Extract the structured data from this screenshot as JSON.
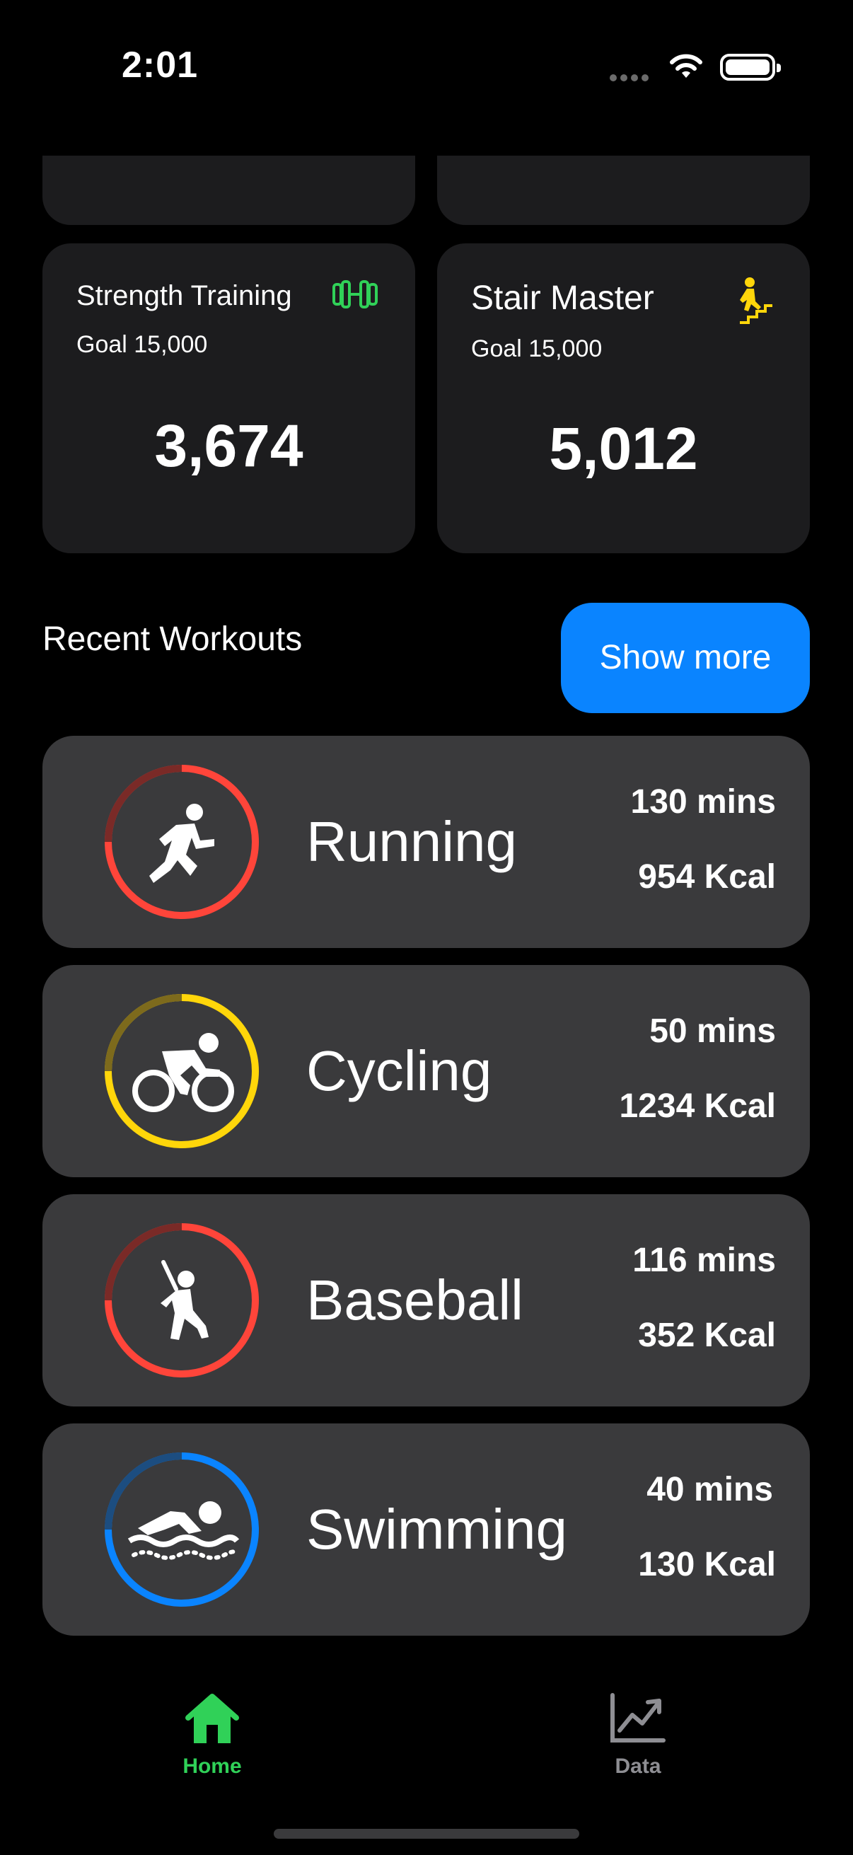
{
  "status_bar": {
    "time": "2:01"
  },
  "stats": [
    {
      "title": "Strength Training",
      "goal": "Goal 15,000",
      "value": "3,674",
      "icon": "dumbbell-icon",
      "icon_color": "#30d158"
    },
    {
      "title": "Stair Master",
      "goal": "Goal 15,000",
      "value": "5,012",
      "icon": "stairs-icon",
      "icon_color": "#ffd60a"
    }
  ],
  "recent": {
    "title": "Recent Workouts",
    "show_more_label": "Show more",
    "items": [
      {
        "name": "Running",
        "duration": "130 mins",
        "calories": "954 Kcal",
        "icon": "running-icon",
        "ring_color": "#ff453a"
      },
      {
        "name": "Cycling",
        "duration": "50 mins",
        "calories": "1234 Kcal",
        "icon": "cycling-icon",
        "ring_color": "#ffd60a"
      },
      {
        "name": "Baseball",
        "duration": "116 mins",
        "calories": "352 Kcal",
        "icon": "baseball-icon",
        "ring_color": "#ff453a"
      },
      {
        "name": "Swimming",
        "duration": "40 mins",
        "calories": "130 Kcal",
        "icon": "swimming-icon",
        "ring_color": "#0a84ff"
      }
    ]
  },
  "tab_bar": {
    "home_label": "Home",
    "data_label": "Data",
    "active_color": "#30d158",
    "inactive_color": "#8e8e93"
  }
}
